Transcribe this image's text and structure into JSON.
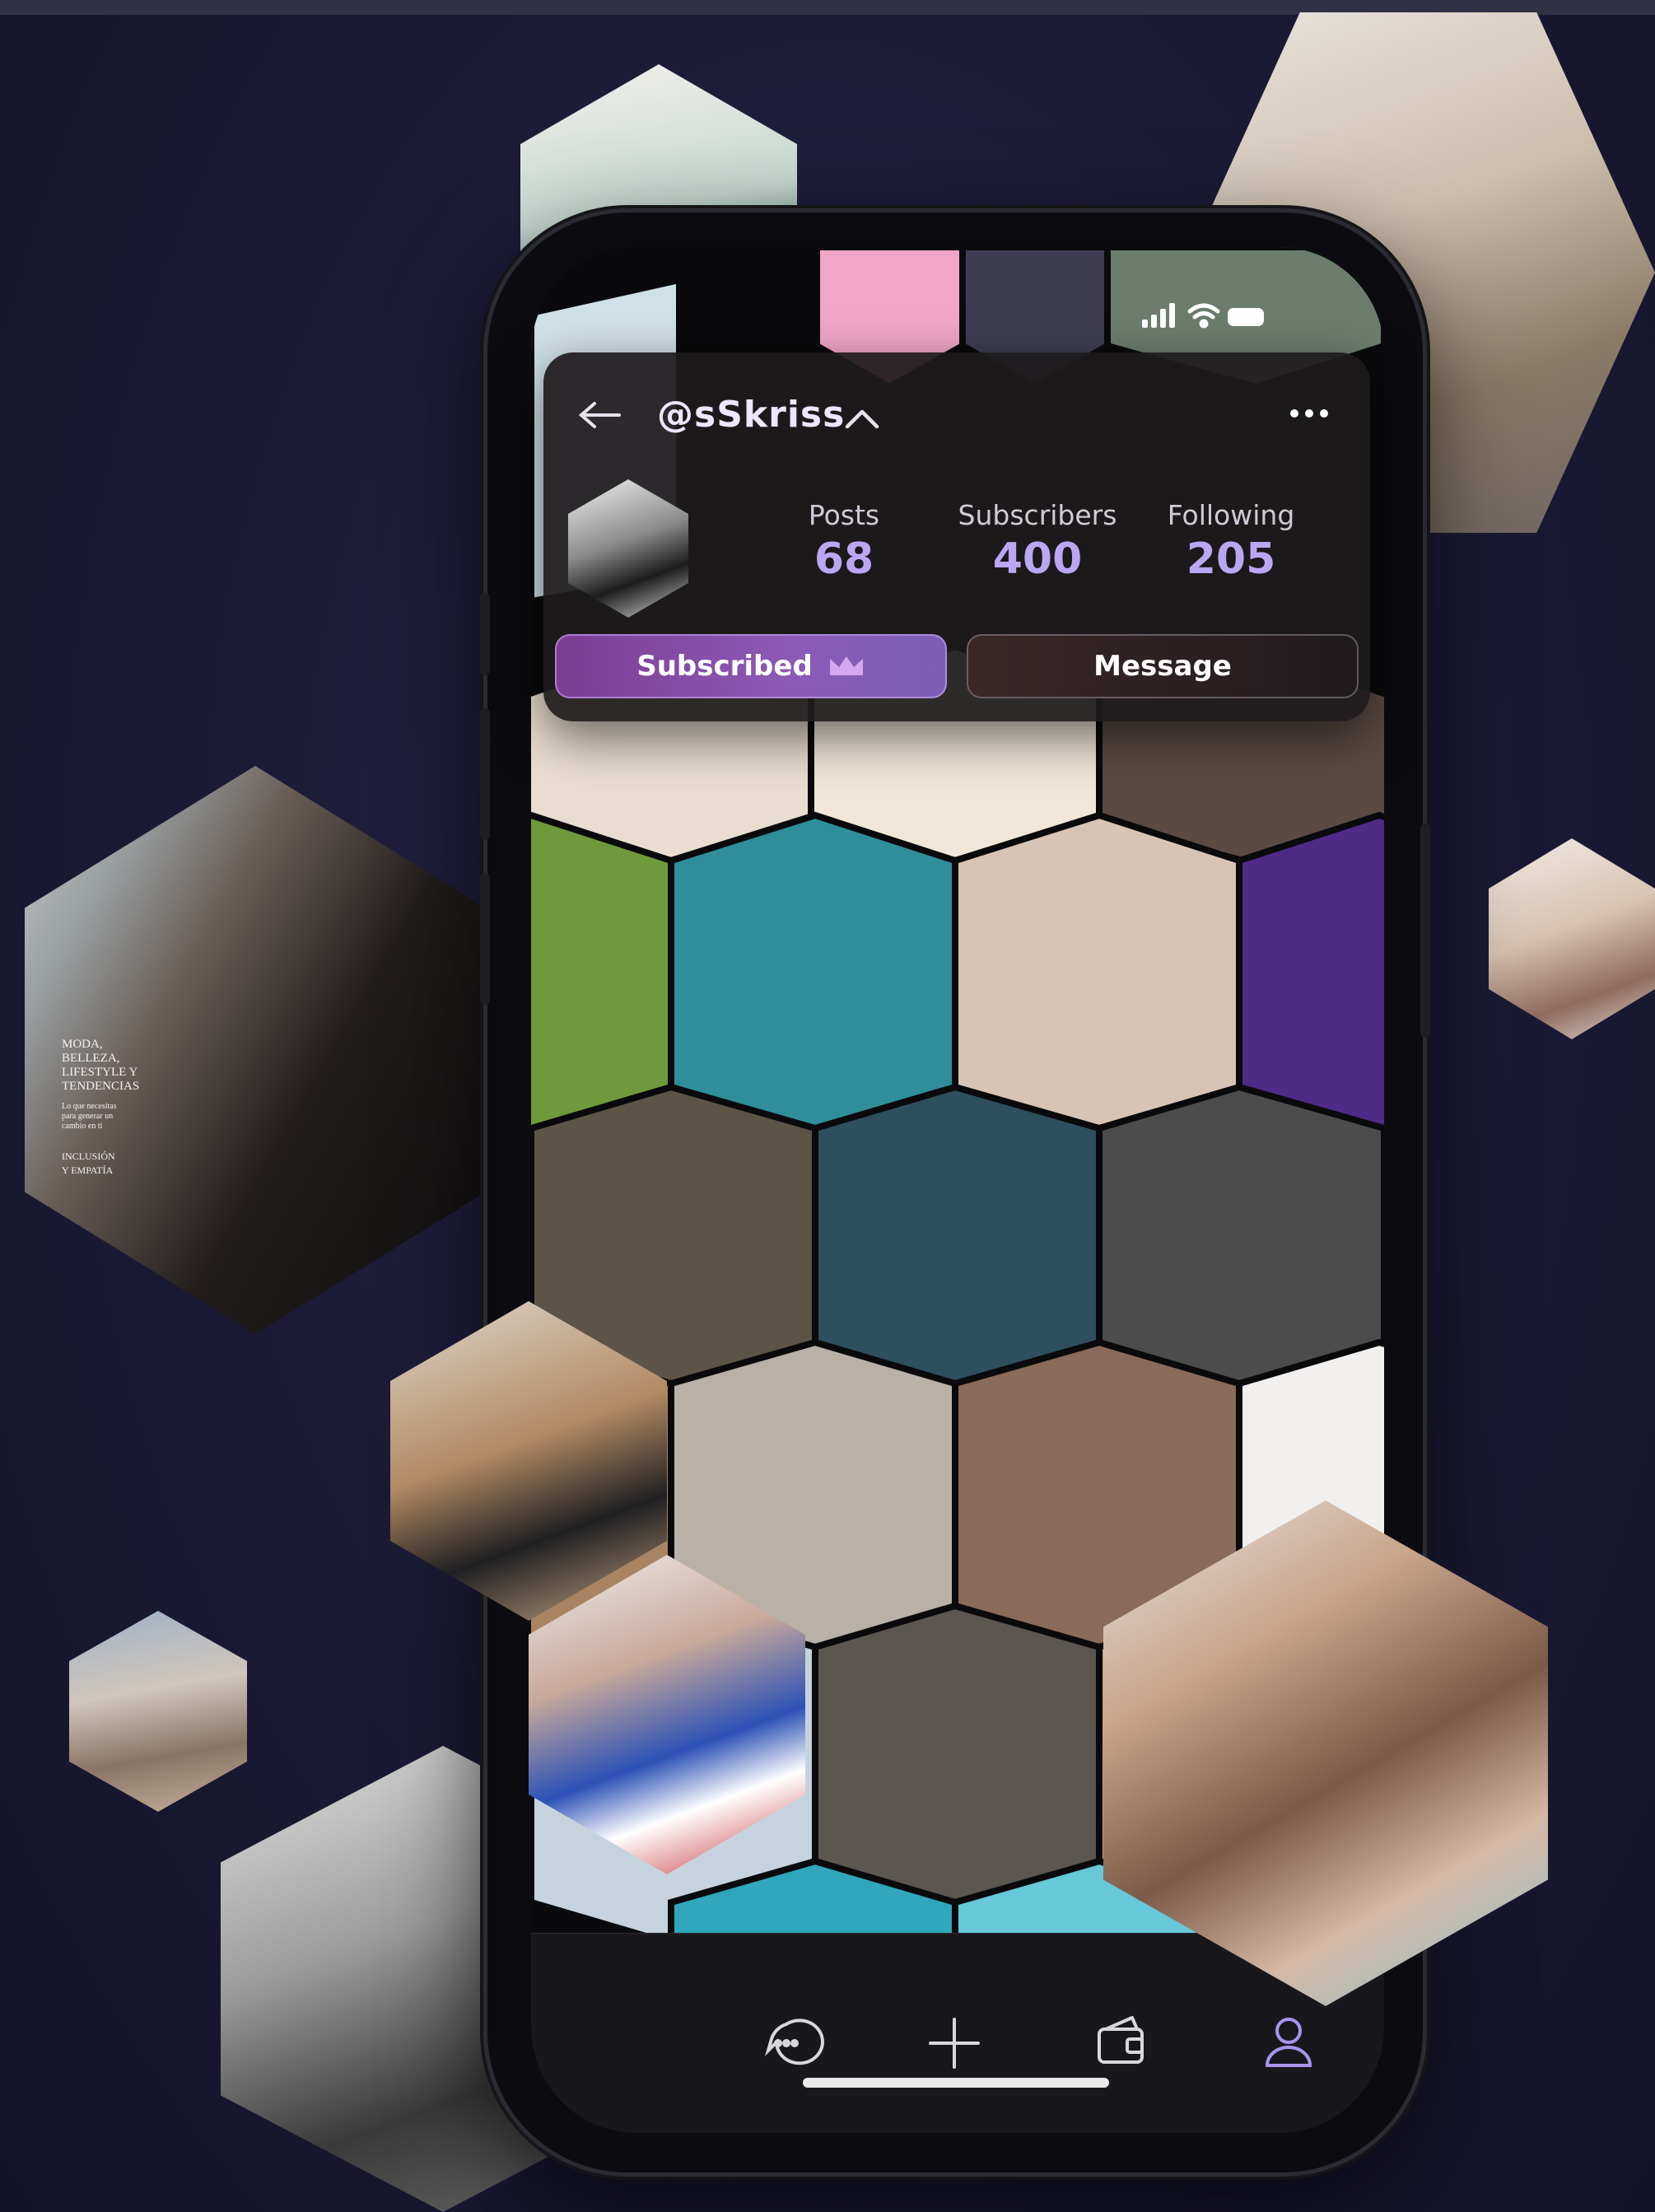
{
  "status_bar": {
    "signal_icon": "signal-bars-icon",
    "wifi_icon": "wifi-icon",
    "battery_icon": "battery-icon"
  },
  "profile": {
    "back_icon": "arrow-left-icon",
    "handle": "@sSkriss",
    "handle_toggle_icon": "chevron-up-icon",
    "more_icon": "more-dots-icon",
    "stats": [
      {
        "label": "Posts",
        "value": "68"
      },
      {
        "label": "Subscribers",
        "value": "400"
      },
      {
        "label": "Following",
        "value": "205"
      }
    ],
    "subscribed_label": "Subscribed",
    "subscribed_icon": "crown-icon",
    "message_label": "Message"
  },
  "bottom_nav": [
    {
      "name": "chat",
      "icon": "chat-bubble-icon"
    },
    {
      "name": "create",
      "icon": "plus-icon"
    },
    {
      "name": "wallet",
      "icon": "wallet-icon"
    },
    {
      "name": "profile",
      "icon": "person-icon",
      "active": true
    }
  ],
  "colors": {
    "accent": "#bba6f3",
    "subscribed_gradient_start": "#7c3d92",
    "subscribed_gradient_end": "#7a5fb6",
    "background": "#1b1a35"
  },
  "magazine_cover": {
    "lines": [
      "MODA,",
      "BELLEZA,",
      "LIFESTYLE Y",
      "TENDENCIAS",
      "Lo que necesitas",
      "para generar un",
      "cambio en ti",
      "INCLUSIÓN",
      "Y EMPATÍA"
    ]
  }
}
